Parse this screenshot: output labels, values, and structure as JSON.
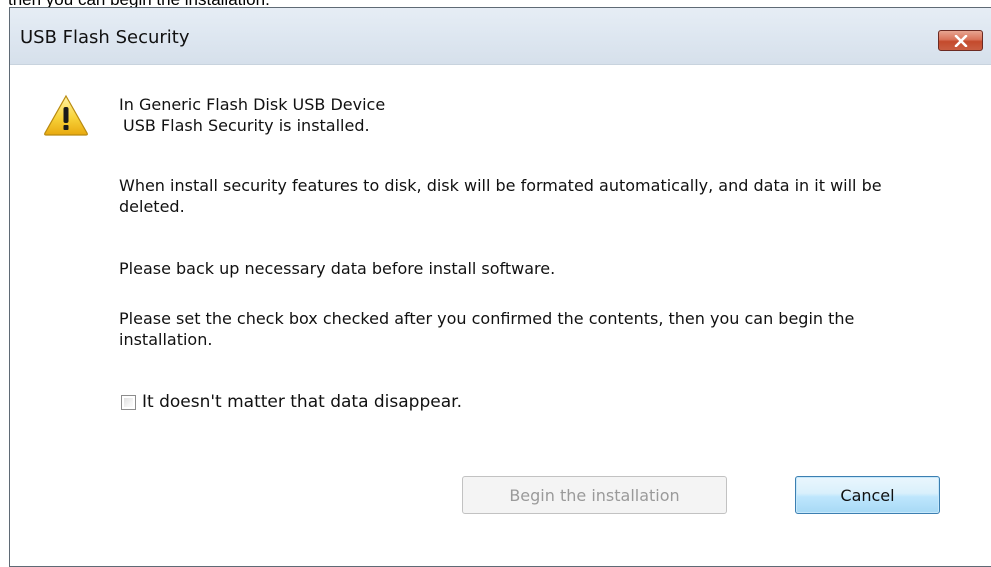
{
  "page": {
    "top_text": "then you can begin the installation."
  },
  "dialog": {
    "title": "USB Flash Security",
    "close_icon": "close-x-icon",
    "warning_icon": "warning-triangle-icon",
    "line1": "In Generic Flash Disk USB Device",
    "line2": "USB Flash Security is installed.",
    "paragraph1": "When install security features to disk, disk will be formated automatically, and data in it will be deleted.",
    "paragraph2": "Please back up necessary data before install software.",
    "paragraph3": "Please set the check box checked after you confirmed the contents, then you can begin the installation.",
    "checkbox_label": "It doesn't matter that data disappear.",
    "checkbox_checked": false,
    "begin_button_label": "Begin the installation",
    "begin_button_enabled": false,
    "cancel_button_label": "Cancel"
  },
  "colors": {
    "titlebar": "#dde6f0",
    "close_button": "#c44a2c",
    "cancel_border": "#3c7fb1",
    "disabled_text": "#9a9a9a"
  }
}
